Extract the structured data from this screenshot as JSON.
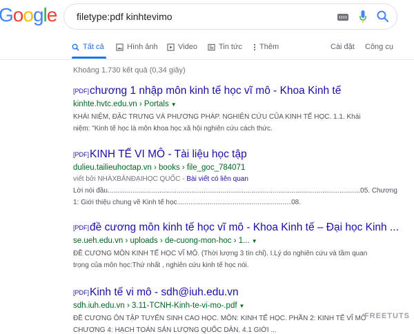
{
  "logo": {
    "letters": [
      "o",
      "o",
      "g",
      "l",
      "e"
    ],
    "colors": [
      "#ea4335",
      "#fbbc05",
      "#4285f4",
      "#34a853",
      "#ea4335"
    ],
    "partial": "G",
    "partial_color": "#4285f4"
  },
  "search": {
    "query": "filetype:pdf kinhtevimo",
    "icons": [
      "keyboard-icon",
      "mic-icon",
      "search-icon"
    ]
  },
  "tabs": [
    {
      "label": "Tất cả",
      "icon": "search-icon",
      "active": true
    },
    {
      "label": "Hình ảnh",
      "icon": "image-icon"
    },
    {
      "label": "Video",
      "icon": "video-icon"
    },
    {
      "label": "Tin tức",
      "icon": "news-icon"
    },
    {
      "label": "Thêm",
      "icon": "more-icon"
    },
    {
      "label": "Cài đặt"
    },
    {
      "label": "Công cụ"
    }
  ],
  "stats": "Khoảng 1.730 kết quả (0,34 giây)",
  "results": [
    {
      "badge": "[PDF]",
      "title": "chương 1 nhập môn kinh tế học vĩ mô - Khoa Kinh tế",
      "url": "kinhte.hvtc.edu.vn › Portals",
      "snippet": [
        "KHÁI NIỆM, ĐẶC TRƯNG VÀ PHƯƠNG PHÁP. NGHIÊN CỨU CỦA KINH TẾ HỌC. 1.1. Khái",
        "niệm: \"Kinh tế học là môn khoa học xã hội nghiên cứu cách thức."
      ]
    },
    {
      "badge": "[PDF]",
      "title": "KINH TẾ VI MÔ - Tài liệu học tập",
      "url": "dulieu.tailieuhoctap.vn › books › file_goc_784071",
      "by_prefix": "viết bởi NHÀXBẢNĐẠIHỌC QUỐC - ",
      "by_link": "Bài viết có liên quan",
      "toc": [
        {
          "left": "Lời nói đầu",
          "right": "05. Chương"
        },
        {
          "left": "1: Giới thiệu chung về Kinh tế học",
          "right": "08."
        }
      ]
    },
    {
      "badge": "[PDF]",
      "title": "đề cương môn kinh tế học vĩ mô - Khoa Kinh tế – Đại học Kinh ...",
      "url": "se.ueh.edu.vn › uploads › de-cuong-mon-hoc › 1...",
      "snippet": [
        "ĐỀ CƯƠNG MÔN KINH TẾ HỌC VĨ MÔ. (Thời lượng 3 tín chỉ). I.Lý do nghiên cứu và tầm quan",
        "trọng của môn học:Thứ nhất , nghiên cứu kinh tế học nói."
      ]
    },
    {
      "badge": "[PDF]",
      "title": "Kinh tế vi mô - sdh@iuh.edu.vn",
      "url": "sdh.iuh.edu.vn › 3.11-TCNH-Kinh-te-vi-mo-.pdf",
      "snippet": [
        "ĐỀ CƯƠNG ÔN TẬP TUYỂN SINH CAO HỌC. MÔN: KINH TẾ HỌC. PHẦN 2: KINH TẾ VĨ MÔ",
        "CHƯƠNG 4: HẠCH TOÁN SẢN LƯỢNG QUỐC DÂN. 4.1 GIỚI ..."
      ]
    }
  ],
  "watermark": "FREETUTS",
  "colors": {
    "link": "#1a0dab",
    "url": "#006621",
    "accent": "#1a73e8"
  }
}
